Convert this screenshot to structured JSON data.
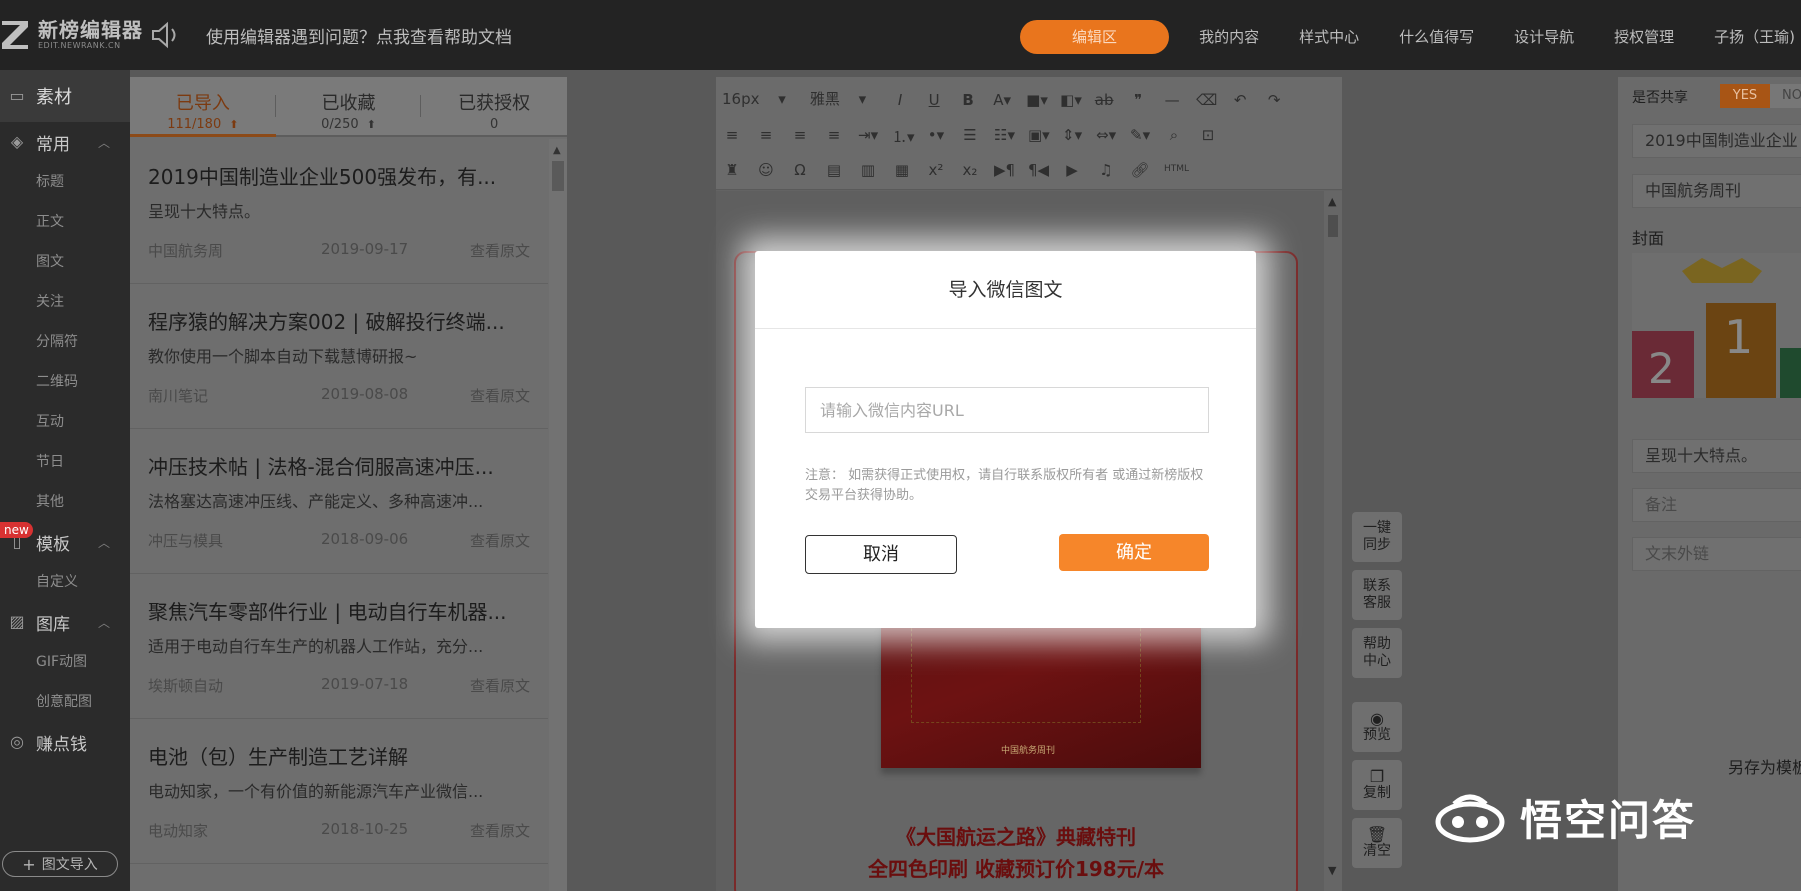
{
  "app": {
    "logo_name": "新榜编辑器",
    "logo_sub": "EDIT.NEWRANK.CN",
    "help_text": "使用编辑器遇到问题？点我查看帮助文档"
  },
  "topnav": {
    "items": [
      "编辑区",
      "我的内容",
      "样式中心",
      "什么值得写",
      "设计导航",
      "授权管理"
    ],
    "user": "子扬（王瑜)"
  },
  "sidebar": {
    "sections": [
      {
        "label": "素材",
        "icon": "book-icon"
      },
      {
        "label": "常用",
        "icon": "layers-icon",
        "items": [
          "标题",
          "正文",
          "图文",
          "关注",
          "分隔符",
          "二维码",
          "互动",
          "节日",
          "其他"
        ]
      },
      {
        "label": "模板",
        "icon": "template-icon",
        "badge": "new",
        "items": [
          "自定义"
        ]
      },
      {
        "label": "图库",
        "icon": "image-icon",
        "items": [
          "GIF动图",
          "创意配图"
        ]
      },
      {
        "label": "赚点钱",
        "icon": "coin-icon"
      }
    ],
    "import_button": "图文导入"
  },
  "list_tabs": [
    {
      "label": "已导入",
      "count": "111/180"
    },
    {
      "label": "已收藏",
      "count": "0/250"
    },
    {
      "label": "已获授权",
      "count": "0"
    }
  ],
  "articles": [
    {
      "title": "2019中国制造业企业500强发布，有...",
      "desc": "呈现十大特点。",
      "source": "中国航务周",
      "date": "2019-09-17",
      "action": "查看原文"
    },
    {
      "title": "程序猿的解决方案002 | 破解投行终端...",
      "desc": "教你使用一个脚本自动下载慧博研报~",
      "source": "南川笔记",
      "date": "2019-08-08",
      "action": "查看原文"
    },
    {
      "title": "冲压技术帖 | 法格-混合伺服高速冲压...",
      "desc": "法格塞达高速冲压线、产能定义、多种高速冲...",
      "source": "冲压与模具",
      "date": "2018-09-06",
      "action": "查看原文"
    },
    {
      "title": "聚焦汽车零部件行业 | 电动自行车机器...",
      "desc": "适用于电动自行车生产的机器人工作站，充分...",
      "source": "埃斯顿自动",
      "date": "2019-07-18",
      "action": "查看原文"
    },
    {
      "title": "电池（包）生产制造工艺详解",
      "desc": "电动知家，一个有价值的新能源汽车产业微信...",
      "source": "电动知家",
      "date": "2018-10-25",
      "action": "查看原文"
    }
  ],
  "editor": {
    "font_size": "16px",
    "font_family": "雅黑",
    "html_label": "HTML",
    "promo_line1": "《大国航运之路》典藏特刊",
    "promo_line2": "全四色印刷  收藏预订价198元/本",
    "book_brand": "中国航务周刊"
  },
  "float_buttons": [
    {
      "label": "一键同步"
    },
    {
      "label": "联系客服"
    },
    {
      "label": "帮助中心"
    },
    {
      "label": "预览",
      "icon": "eye-icon"
    },
    {
      "label": "复制",
      "icon": "copy-icon"
    },
    {
      "label": "清空",
      "icon": "trash-icon"
    }
  ],
  "right_panel": {
    "share_label": "是否共享",
    "yes": "YES",
    "no": "NO",
    "title_value": "2019中国制造业企业",
    "author_value": "中国航务周刊",
    "cover_label": "封面",
    "summary_value": "呈现十大特点。",
    "remark_placeholder": "备注",
    "link_placeholder": "文末外链",
    "save_as": "另存为模板"
  },
  "modal": {
    "title": "导入微信图文",
    "input_placeholder": "请输入微信内容URL",
    "note": "注意：  如需获得正式使用权，请自行联系版权所有者 或通过新榜版权交易平台获得协助。",
    "cancel": "取消",
    "confirm": "确定"
  },
  "watermark": "悟空问答",
  "colors": {
    "accent": "#f6862a",
    "topbar": "#232323",
    "sidebar": "#2b2b2b"
  }
}
